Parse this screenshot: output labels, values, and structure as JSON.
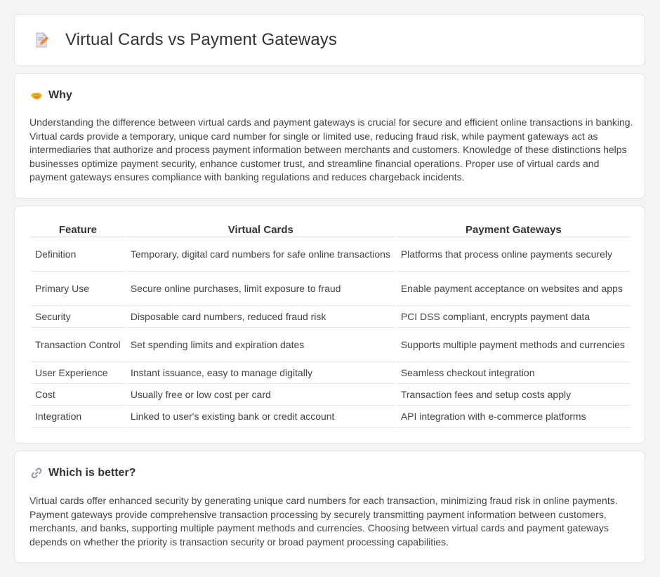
{
  "header": {
    "title": "Virtual Cards vs Payment Gateways",
    "icon": "document-edit-icon"
  },
  "why": {
    "icon": "handshake-icon",
    "title": "Why",
    "text": "Understanding the difference between virtual cards and payment gateways is crucial for secure and efficient online transactions in banking. Virtual cards provide a temporary, unique card number for single or limited use, reducing fraud risk, while payment gateways act as intermediaries that authorize and process payment information between merchants and customers. Knowledge of these distinctions helps businesses optimize payment security, enhance customer trust, and streamline financial operations. Proper use of virtual cards and payment gateways ensures compliance with banking regulations and reduces chargeback incidents."
  },
  "table": {
    "headers": [
      "Feature",
      "Virtual Cards",
      "Payment Gateways"
    ],
    "rows": [
      [
        "Definition",
        "Temporary, digital card numbers for safe online transactions",
        "Platforms that process online payments securely"
      ],
      [
        "Primary Use",
        "Secure online purchases, limit exposure to fraud",
        "Enable payment acceptance on websites and apps"
      ],
      [
        "Security",
        "Disposable card numbers, reduced fraud risk",
        "PCI DSS compliant, encrypts payment data"
      ],
      [
        "Transaction Control",
        "Set spending limits and expiration dates",
        "Supports multiple payment methods and currencies"
      ],
      [
        "User Experience",
        "Instant issuance, easy to manage digitally",
        "Seamless checkout integration"
      ],
      [
        "Cost",
        "Usually free or low cost per card",
        "Transaction fees and setup costs apply"
      ],
      [
        "Integration",
        "Linked to user's existing bank or credit account",
        "API integration with e-commerce platforms"
      ]
    ]
  },
  "better": {
    "icon": "link-icon",
    "title": "Which is better?",
    "text": "Virtual cards offer enhanced security by generating unique card numbers for each transaction, minimizing fraud risk in online payments. Payment gateways provide comprehensive transaction processing by securely transmitting payment information between customers, merchants, and banks, supporting multiple payment methods and currencies. Choosing between virtual cards and payment gateways depends on whether the priority is transaction security or broad payment processing capabilities."
  }
}
